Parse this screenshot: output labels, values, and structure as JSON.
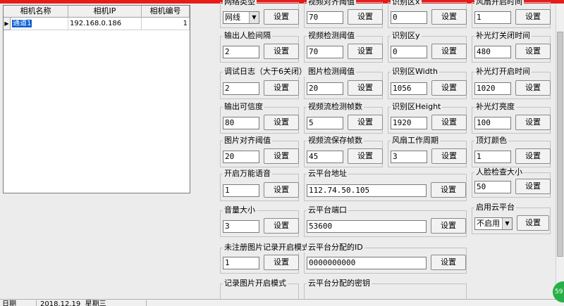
{
  "grid": {
    "headers": [
      "相机名称",
      "相机IP",
      "相机编号"
    ],
    "row": {
      "name": "通道1",
      "ip": "192.168.0.186",
      "number": "1"
    },
    "row_marker": "▶"
  },
  "groups": {
    "network_type": {
      "label": "网络类型",
      "value": "网线",
      "button": "设置"
    },
    "video_align": {
      "label": "视频对齐阈值",
      "value": "70",
      "button": "设置"
    },
    "region_x": {
      "label": "识别区x",
      "value": "0",
      "button": "设置"
    },
    "fan_open_time": {
      "label": "风扇开启时间",
      "value": "1",
      "button": "设置"
    },
    "face_interval": {
      "label": "输出人脸间隔",
      "value": "2",
      "button": "设置"
    },
    "video_detect": {
      "label": "视频检测阈值",
      "value": "70",
      "button": "设置"
    },
    "region_y": {
      "label": "识别区y",
      "value": "0",
      "button": "设置"
    },
    "fill_close_time": {
      "label": "补光灯关闭时间",
      "value": "480",
      "button": "设置"
    },
    "debug_log": {
      "label": "调试日志（大于6关闭）",
      "value": "2",
      "button": "设置"
    },
    "image_detect": {
      "label": "图片检测阈值",
      "value": "20",
      "button": "设置"
    },
    "region_width": {
      "label": "识别区Width",
      "value": "1056",
      "button": "设置"
    },
    "fill_open_time": {
      "label": "补光灯开启时间",
      "value": "1020",
      "button": "设置"
    },
    "confidence": {
      "label": "输出可信度",
      "value": "80",
      "button": "设置"
    },
    "stream_frames": {
      "label": "视频流检测帧数",
      "value": "5",
      "button": "设置"
    },
    "region_height": {
      "label": "识别区Height",
      "value": "1920",
      "button": "设置"
    },
    "fill_brightness": {
      "label": "补光灯亮度",
      "value": "100",
      "button": "设置"
    },
    "image_align": {
      "label": "图片对齐阈值",
      "value": "20",
      "button": "设置"
    },
    "stream_save": {
      "label": "视频流保存帧数",
      "value": "45",
      "button": "设置"
    },
    "fan_cycle": {
      "label": "风扇工作周期",
      "value": "3",
      "button": "设置"
    },
    "top_light": {
      "label": "顶灯颜色",
      "value": "1",
      "button": "设置"
    },
    "universal_voice": {
      "label": "开启万能语音",
      "value": "1",
      "button": "设置"
    },
    "cloud_address": {
      "label": "云平台地址",
      "value": "112.74.50.105",
      "button": "设置"
    },
    "face_size": {
      "label": "人脸检查大小",
      "value": "50",
      "button": "设置"
    },
    "volume": {
      "label": "音量大小",
      "value": "3",
      "button": "设置"
    },
    "cloud_port": {
      "label": "云平台端口",
      "value": "53600",
      "button": "设置"
    },
    "enable_cloud": {
      "label": "启用云平台",
      "value": "不启用",
      "button": "设置"
    },
    "unreg_image_mode": {
      "label": "未注册图片记录开启模式",
      "value": "1",
      "button": "设置"
    },
    "cloud_id": {
      "label": "云平台分配的ID",
      "value": "0000000000",
      "button": "设置"
    },
    "image_record_mode": {
      "label": "记录图片开启模式"
    },
    "cloud_key": {
      "label": "云平台分配的密钥"
    }
  },
  "status": {
    "date_label": "日期",
    "date_value": "2018.12.19",
    "weekday": "星期三"
  },
  "badge": "59",
  "colors": {
    "top_bar": "#e81a1a",
    "selection": "#0a5fd0",
    "badge": "#28b048"
  }
}
